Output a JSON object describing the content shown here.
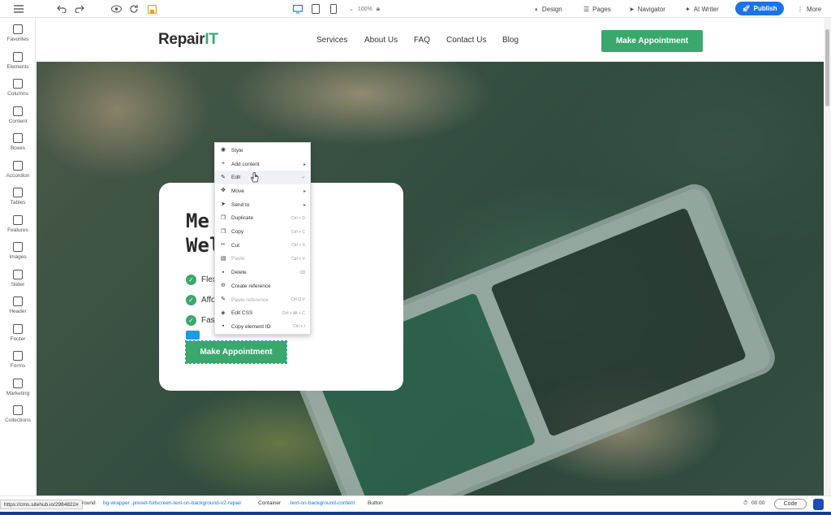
{
  "toolbar": {
    "zoom": "100%",
    "design": "Design",
    "pages": "Pages",
    "navigator": "Navigator",
    "ai_writer": "AI Writer",
    "publish": "Publish",
    "more": "More"
  },
  "sidebar": {
    "items": [
      {
        "label": "Favorites",
        "icon": "star-icon"
      },
      {
        "label": "Elements",
        "icon": "cube-icon"
      },
      {
        "label": "Columns",
        "icon": "columns-icon"
      },
      {
        "label": "Content",
        "icon": "document-icon"
      },
      {
        "label": "Boxes",
        "icon": "box-icon"
      },
      {
        "label": "Accordion",
        "icon": "accordion-icon"
      },
      {
        "label": "Tables",
        "icon": "table-icon"
      },
      {
        "label": "Features",
        "icon": "features-icon"
      },
      {
        "label": "Images",
        "icon": "image-icon"
      },
      {
        "label": "Slider",
        "icon": "slider-icon"
      },
      {
        "label": "Header",
        "icon": "header-icon"
      },
      {
        "label": "Footer",
        "icon": "footer-icon"
      },
      {
        "label": "Forms",
        "icon": "forms-icon"
      },
      {
        "label": "Marketing",
        "icon": "marketing-icon"
      },
      {
        "label": "Collections",
        "icon": "collections-icon"
      }
    ]
  },
  "site": {
    "logo_main": "Repair",
    "logo_accent": "IT",
    "nav": [
      "Services",
      "About Us",
      "FAQ",
      "Contact Us",
      "Blog"
    ],
    "header_button": "Make Appointment",
    "hero_line1": "Me",
    "hero_line1_end": "e",
    "hero_line2": "Wel",
    "features": [
      "Flex",
      "Affo",
      "Fas"
    ],
    "hero_button": "Make Appointment"
  },
  "context_menu": {
    "items": [
      {
        "label": "Style",
        "shortcut": "",
        "submenu": false,
        "disabled": false
      },
      {
        "label": "Add content",
        "shortcut": "",
        "submenu": true,
        "disabled": false
      },
      {
        "label": "Edit",
        "shortcut": "↵",
        "submenu": false,
        "disabled": false
      },
      {
        "label": "Move",
        "shortcut": "",
        "submenu": true,
        "disabled": false
      },
      {
        "label": "Send to",
        "shortcut": "",
        "submenu": true,
        "disabled": false
      },
      {
        "label": "Duplicate",
        "shortcut": "Ctrl + D",
        "submenu": false,
        "disabled": false
      },
      {
        "label": "Copy",
        "shortcut": "Ctrl + C",
        "submenu": false,
        "disabled": false
      },
      {
        "label": "Cut",
        "shortcut": "Ctrl + X",
        "submenu": false,
        "disabled": false
      },
      {
        "label": "Paste",
        "shortcut": "Ctrl + V",
        "submenu": false,
        "disabled": true
      },
      {
        "label": "Delete",
        "shortcut": "⌫",
        "submenu": false,
        "disabled": false
      },
      {
        "label": "Create reference",
        "shortcut": "",
        "submenu": false,
        "disabled": false
      },
      {
        "label": "Paste reference",
        "shortcut": "Ctrl Q V",
        "submenu": false,
        "disabled": true
      },
      {
        "label": "Edit CSS",
        "shortcut": "Ctrl + Alt + C",
        "submenu": false,
        "disabled": false
      },
      {
        "label": "Copy element ID",
        "shortcut": "Ctrl + I",
        "submenu": false,
        "disabled": false
      }
    ]
  },
  "status": {
    "url": "https://cms.sitehub.io/2984822#",
    "crumb_round": "round",
    "crumb_bg": "bg-wrapper .preset-fullscreen-text-on-background-v2-repair",
    "crumb_container": "Container",
    "crumb_container_class": ".text-on-background-content",
    "crumb_button": "Button",
    "timer": "00 00",
    "code": "Code"
  },
  "colors": {
    "accent": "#3aa76d",
    "publish": "#1a73e8"
  }
}
